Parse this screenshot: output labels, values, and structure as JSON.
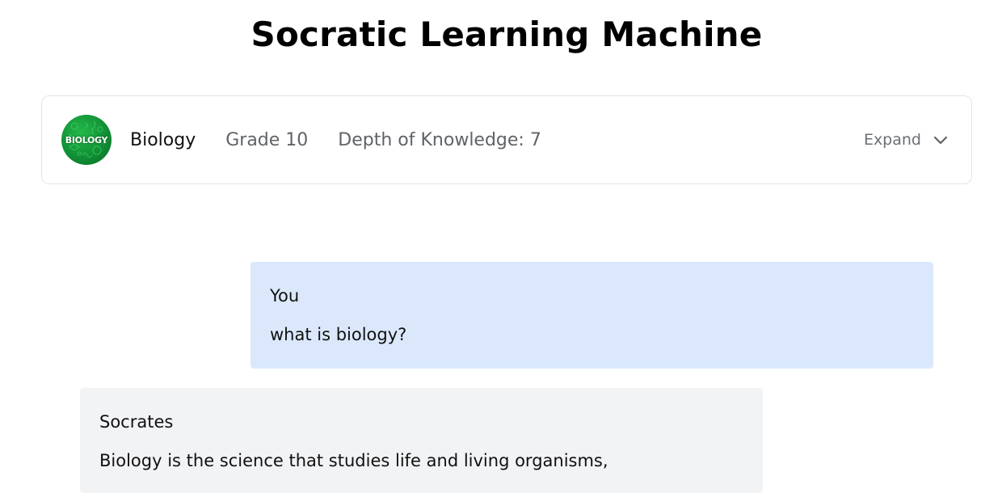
{
  "page": {
    "title": "Socratic Learning Machine"
  },
  "info_card": {
    "logo_text": "BIOLOGY",
    "subject": "Biology",
    "grade": "Grade 10",
    "depth_of_knowledge": "Depth of Knowledge: 7",
    "expand_label": "Expand",
    "expand_icon": "chevron-down-icon",
    "logo_color": "#119035"
  },
  "chat": {
    "messages": [
      {
        "author": "You",
        "text": "what is biology?",
        "background": "#dbe8fb"
      },
      {
        "author": "Socrates",
        "text": "Biology is the science that studies life and living organisms,",
        "background": "#f2f3f5"
      }
    ]
  }
}
